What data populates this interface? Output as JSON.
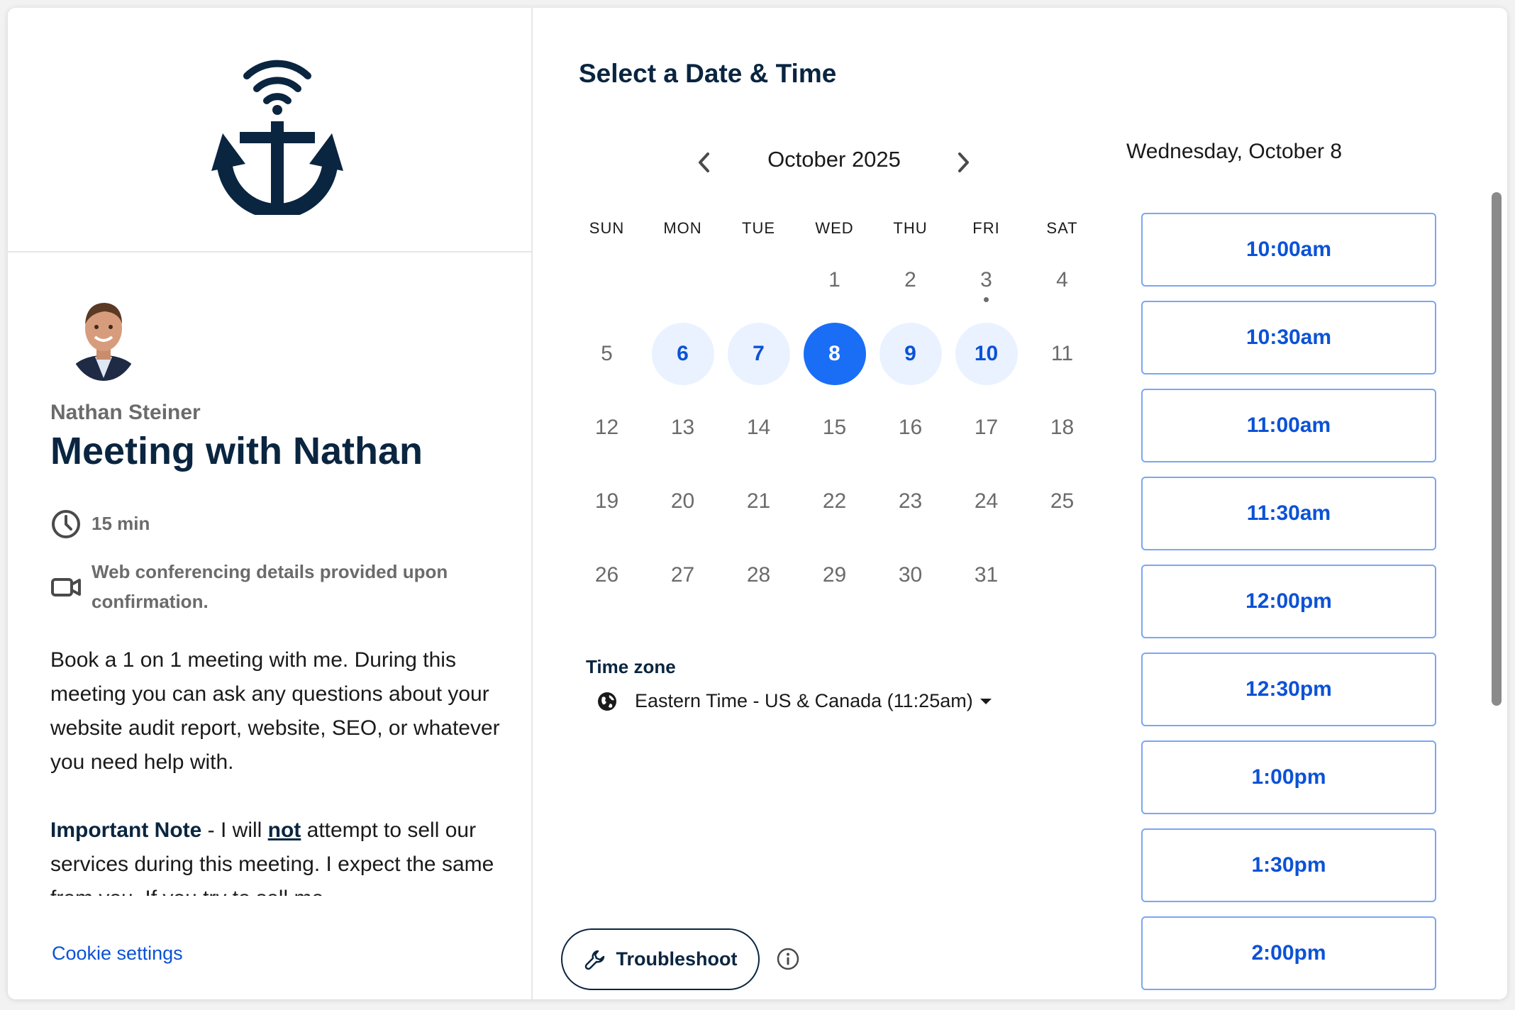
{
  "colors": {
    "brand_dark": "#0a2540",
    "accent_blue": "#0b52d6",
    "selected_blue": "#1a6ef5",
    "available_bg": "#eaf2ff",
    "muted_text": "#6b6b6b"
  },
  "profile": {
    "logo_icon": "anchor-with-signal-icon",
    "avatar": "profile-photo",
    "owner_name": "Nathan Steiner",
    "event_title": "Meeting with Nathan",
    "duration_icon": "clock-icon",
    "duration": "15 min",
    "conferencing_icon": "video-camera-icon",
    "conferencing": "Web conferencing details provided upon confirmation.",
    "description_p1": "Book a 1 on 1 meeting with me. During this meeting you can ask any questions about your website audit report, website, SEO, or whatever you need help with.",
    "note_label": "Important Note",
    "note_sep": " - I will ",
    "note_not": "not",
    "note_rest": " attempt to sell our services during this meeting. I expect the same from you. If you try to sell me",
    "cookie_settings": "Cookie settings"
  },
  "calendar": {
    "title": "Select a Date & Time",
    "month_label": "October 2025",
    "prev_icon": "chevron-left-icon",
    "next_icon": "chevron-right-icon",
    "weekdays": [
      "SUN",
      "MON",
      "TUE",
      "WED",
      "THU",
      "FRI",
      "SAT"
    ],
    "first_weekday_index": 3,
    "days_in_month": 31,
    "today": 3,
    "available_days": [
      6,
      7,
      9,
      10
    ],
    "selected_day": 8,
    "timezone_label": "Time zone",
    "timezone_icon": "globe-icon",
    "timezone_value": "Eastern Time - US & Canada (11:25am)",
    "troubleshoot_label": "Troubleshoot",
    "troubleshoot_icon": "wrench-icon",
    "info_icon": "info-icon"
  },
  "slots": {
    "selected_date_label": "Wednesday, October 8",
    "times": [
      "10:00am",
      "10:30am",
      "11:00am",
      "11:30am",
      "12:00pm",
      "12:30pm",
      "1:00pm",
      "1:30pm",
      "2:00pm"
    ]
  }
}
